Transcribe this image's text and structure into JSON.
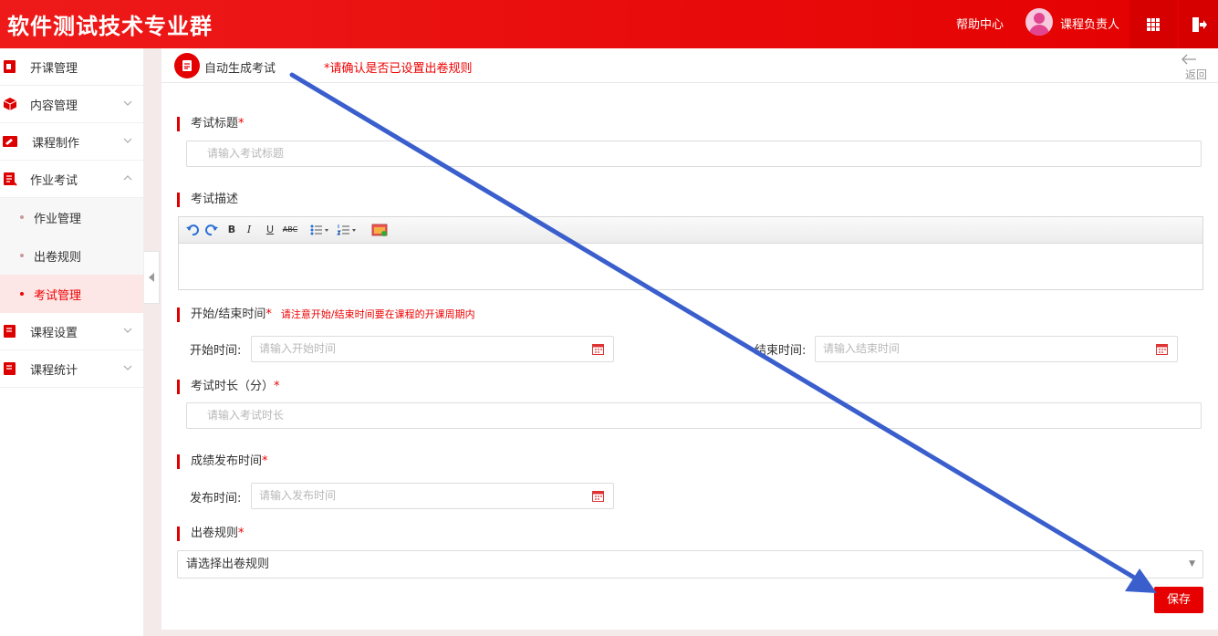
{
  "header": {
    "brand": "软件测试技术专业群",
    "help": "帮助中心",
    "user": "课程负责人"
  },
  "sidebar": {
    "items": [
      {
        "label": "开课管理"
      },
      {
        "label": "内容管理"
      },
      {
        "label": "课程制作"
      },
      {
        "label": "作业考试"
      }
    ],
    "subitems": [
      {
        "label": "作业管理"
      },
      {
        "label": "出卷规则"
      },
      {
        "label": "考试管理"
      }
    ],
    "items_after": [
      {
        "label": "课程设置"
      },
      {
        "label": "课程统计"
      }
    ]
  },
  "page": {
    "title": "自动生成考试",
    "notice": "*请确认是否已设置出卷规则",
    "back": "返回"
  },
  "form": {
    "exam_title_label": "考试标题",
    "exam_title_placeholder": "请输入考试标题",
    "desc_label": "考试描述",
    "time_label": "开始/结束时间",
    "time_hint": "请注意开始/结束时间要在课程的开课周期内",
    "start_label": "开始时间:",
    "start_placeholder": "请输入开始时间",
    "end_label": "结束时间:",
    "end_placeholder": "请输入结束时间",
    "duration_label": "考试时长（分）",
    "duration_placeholder": "请输入考试时长",
    "publish_section_label": "成绩发布时间",
    "publish_label": "发布时间:",
    "publish_placeholder": "请输入发布时间",
    "rule_label": "出卷规则",
    "rule_select": "请选择出卷规则",
    "required_mark": "*",
    "save": "保存"
  },
  "editor_toolbar": {
    "bold": "B",
    "italic": "I",
    "underline": "U",
    "strike": "ABC"
  },
  "colors": {
    "brand_red": "#e40000",
    "annotation_arrow": "#3a5fcd"
  }
}
